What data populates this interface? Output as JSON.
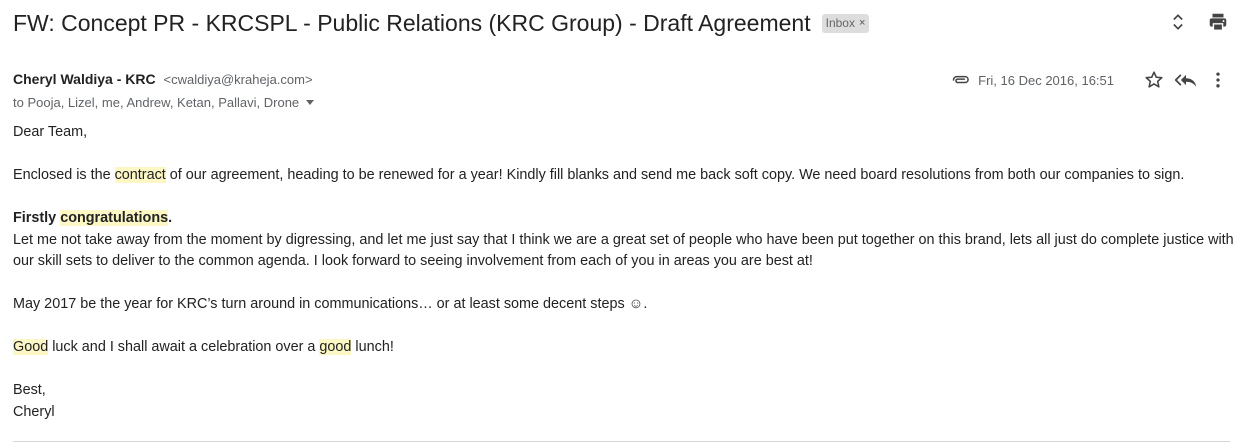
{
  "email": {
    "subject": "FW: Concept PR - KRCSPL - Public Relations (KRC Group) - Draft Agreement",
    "label": "Inbox",
    "label_remove": "×",
    "sender_name": "Cheryl Waldiya - KRC",
    "sender_email": "<cwaldiya@kraheja.com>",
    "recipients": "to Pooja, Lizel, me, Andrew, Ketan, Pallavi, Drone",
    "date": "Fri, 16 Dec 2016, 16:51"
  },
  "body": {
    "greeting": "Dear Team,",
    "p1_pre": "Enclosed is the ",
    "p1_hl": "contract",
    "p1_post": " of our agreement, heading to be renewed for a year! Kindly fill blanks and send me back soft copy. We need board resolutions from both our companies to sign.",
    "p2_bold_pre": "Firstly ",
    "p2_bold_hl": "congratulations",
    "p2_bold_post": ".",
    "p2_text": "Let me not take away from the moment by digressing, and let me just say that I think we are a great set of people who have been put together on this brand, lets all just do complete justice with our skill sets to deliver to the common agenda. I look forward to seeing involvement from each of you in areas you are best at!",
    "p3": "May 2017 be the year for KRC’s turn around in communications… or at least some decent steps ☺.",
    "p4_hl1": "Good",
    "p4_mid": " luck and I shall await a celebration over a ",
    "p4_hl2": "good",
    "p4_post": " lunch!",
    "signoff": "Best,",
    "signature": "Cheryl"
  },
  "icons": {
    "expand": "unfold-more-icon",
    "print": "print-icon",
    "attachment": "paperclip-icon",
    "star": "star-icon",
    "reply_all": "reply-all-icon",
    "more": "more-vert-icon"
  },
  "colors": {
    "highlight": "#fcf7c4",
    "text": "#222222",
    "muted": "#5f6368",
    "chip_bg": "#dddddd"
  }
}
